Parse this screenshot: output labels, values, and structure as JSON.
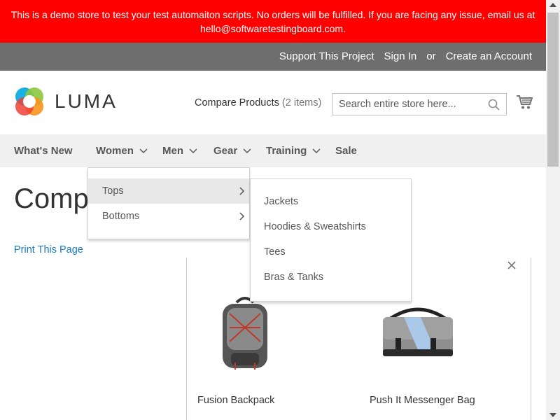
{
  "notice": {
    "line1": "This is a demo store to test your test automaiton scripts. No orders will be fulfilled. If you are facing any issue, email us at",
    "line2": "hello@softwaretestingboard.com."
  },
  "top_links": {
    "support": "Support This Project",
    "sign_in": "Sign In",
    "or": "or",
    "create_account": "Create an Account"
  },
  "logo": {
    "text": "LUMA"
  },
  "compare": {
    "label": "Compare Products",
    "count": "(2 items)"
  },
  "search": {
    "placeholder": "Search entire store here..."
  },
  "nav": {
    "whats_new": "What's New",
    "women": "Women",
    "men": "Men",
    "gear": "Gear",
    "training": "Training",
    "sale": "Sale"
  },
  "women_menu": {
    "tops": "Tops",
    "bottoms": "Bottoms"
  },
  "tops_menu": {
    "jackets": "Jackets",
    "hoodies": "Hoodies & Sweatshirts",
    "tees": "Tees",
    "bras": "Bras & Tanks"
  },
  "page": {
    "title": "Compare Products",
    "print": "Print This Page"
  },
  "products": [
    {
      "name": "Fusion Backpack"
    },
    {
      "name": "Push It Messenger Bag"
    }
  ],
  "colors": {
    "notice_bg": "#ff0000",
    "header_bar": "#6e6e6e",
    "nav_bg": "#f0f0f0",
    "link": "#1979c3"
  }
}
